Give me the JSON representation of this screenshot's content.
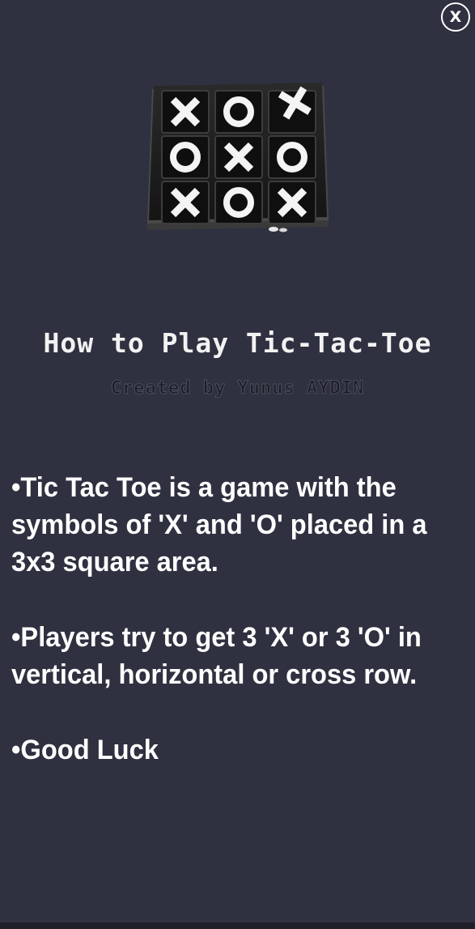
{
  "close_button": {
    "label": "X"
  },
  "header": {
    "title": "How to Play Tic-Tac-Toe",
    "subtitle": "Created by Yunus AYDIN"
  },
  "board": {
    "cells": [
      "X",
      "O",
      "X",
      "O",
      "X",
      "O",
      "X",
      "O",
      "X"
    ]
  },
  "instructions": [
    {
      "text": "•Tic Tac Toe is a game with the symbols of 'X' and 'O' placed in a 3x3 square area."
    },
    {
      "text": "•Players try to get 3 'X' or 3 'O' in vertical, horizontal or cross row."
    },
    {
      "text": "•Good Luck"
    }
  ],
  "colors": {
    "background": "#2f3140",
    "text": "#ffffff"
  }
}
